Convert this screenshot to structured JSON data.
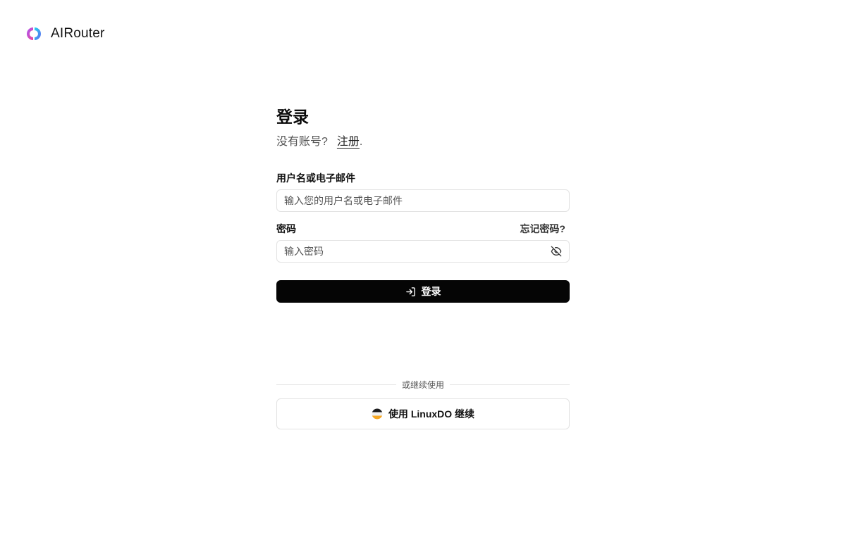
{
  "brand": {
    "name": "AIRouter",
    "logo_icon": "airouter-logo-icon"
  },
  "login": {
    "title": "登录",
    "no_account_text": "没有账号?",
    "register_link": "注册",
    "register_suffix": ".",
    "username_label": "用户名或电子邮件",
    "username_placeholder": "输入您的用户名或电子邮件",
    "password_label": "密码",
    "forgot_password": "忘记密码?",
    "password_placeholder": "输入密码",
    "password_toggle_icon": "eye-off-icon",
    "submit_label": "登录",
    "submit_icon": "log-in-icon"
  },
  "oauth": {
    "divider_text": "或继续使用",
    "linuxdo_label": "使用 LinuxDO 继续",
    "linuxdo_icon": "linuxdo-logo-icon"
  },
  "colors": {
    "primary_button": "#050505",
    "border": "#e2e2e2",
    "logo_gradient": [
      "#8b5cf6",
      "#ec4899",
      "#22d3ee"
    ],
    "linuxdo": [
      "#1c1c1e",
      "#f0f0f0",
      "#f5a623"
    ]
  }
}
